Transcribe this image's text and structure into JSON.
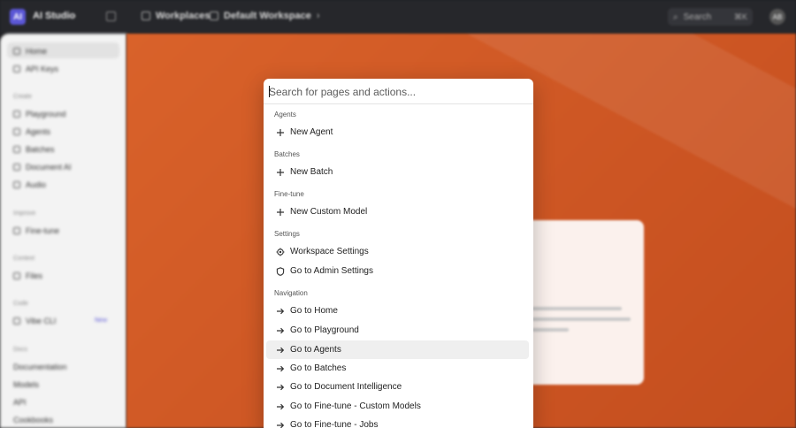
{
  "topbar": {
    "logo_letter": "AI",
    "brand": "AI Studio",
    "workspace_links": [
      "Workplaces",
      "Default Workspace"
    ],
    "search_label": "Search",
    "search_kbd": "⌘K",
    "avatar_initials": "AB"
  },
  "sidebar": {
    "top_items": [
      "Home",
      "API Keys"
    ],
    "sections": [
      {
        "head": "Create",
        "items": [
          "Playground",
          "Agents",
          "Batches",
          "Document AI",
          "Audio"
        ]
      },
      {
        "head": "Improve",
        "items": [
          "Fine-tune"
        ]
      },
      {
        "head": "Context",
        "items": [
          "Files"
        ]
      },
      {
        "head": "Code",
        "items": [
          "Vibe CLI"
        ]
      },
      {
        "head": "Docs",
        "items": [
          "Documentation",
          "Models",
          "API",
          "Cookbooks"
        ]
      }
    ],
    "badge": "New"
  },
  "palette": {
    "placeholder": "Search for pages and actions...",
    "groups": [
      {
        "head": "Agents",
        "items": [
          {
            "label": "New Agent",
            "icon": "plus-icon"
          }
        ]
      },
      {
        "head": "Batches",
        "items": [
          {
            "label": "New Batch",
            "icon": "plus-icon"
          }
        ]
      },
      {
        "head": "Fine-tune",
        "items": [
          {
            "label": "New Custom Model",
            "icon": "plus-icon"
          }
        ]
      },
      {
        "head": "Settings",
        "items": [
          {
            "label": "Workspace Settings",
            "icon": "gear-icon"
          },
          {
            "label": "Go to Admin Settings",
            "icon": "shield-icon"
          }
        ]
      },
      {
        "head": "Navigation",
        "items": [
          {
            "label": "Go to Home",
            "icon": "arrow-right-icon"
          },
          {
            "label": "Go to Playground",
            "icon": "arrow-right-icon"
          },
          {
            "label": "Go to Agents",
            "icon": "arrow-right-icon",
            "selected": true
          },
          {
            "label": "Go to Batches",
            "icon": "arrow-right-icon"
          },
          {
            "label": "Go to Document Intelligence",
            "icon": "arrow-right-icon"
          },
          {
            "label": "Go to Fine-tune - Custom Models",
            "icon": "arrow-right-icon"
          },
          {
            "label": "Go to Fine-tune - Jobs",
            "icon": "arrow-right-icon"
          }
        ]
      }
    ]
  },
  "colors": {
    "accent": "#5b57d6",
    "main_bg": "#d9622a",
    "selected_row": "#efefef"
  }
}
